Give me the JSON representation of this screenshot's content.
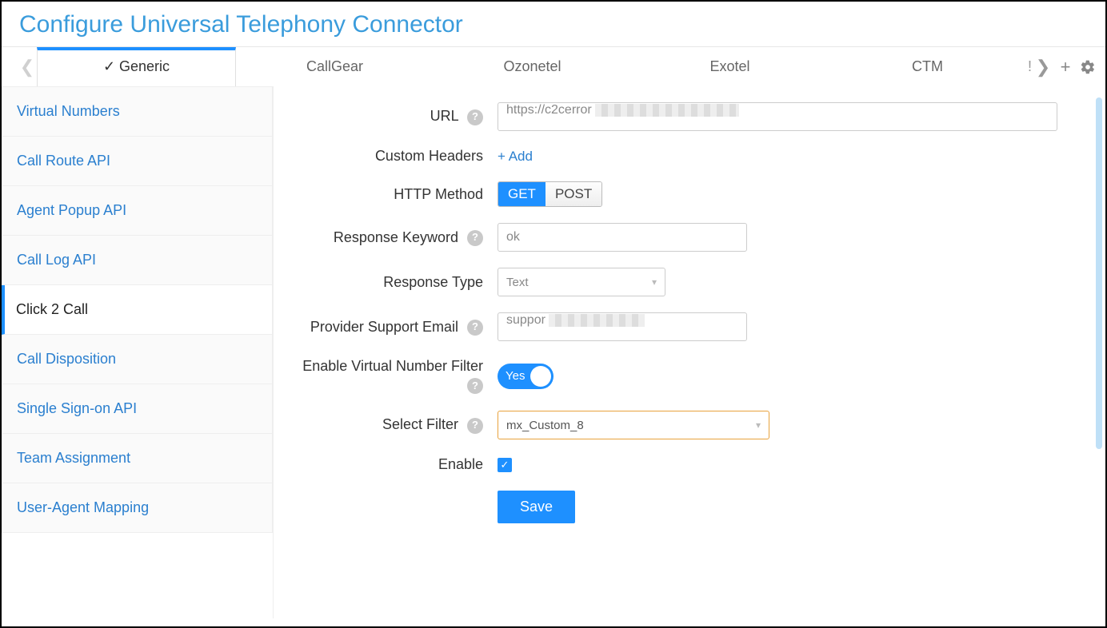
{
  "title": "Configure Universal Telephony Connector",
  "tabs": {
    "items": [
      "✓ Generic",
      "CallGear",
      "Ozonetel",
      "Exotel",
      "CTM"
    ],
    "active_index": 0
  },
  "sidebar": {
    "items": [
      "Virtual Numbers",
      "Call Route API",
      "Agent Popup API",
      "Call Log API",
      "Click 2 Call",
      "Call Disposition",
      "Single Sign-on API",
      "Team Assignment",
      "User-Agent Mapping"
    ],
    "active_index": 4
  },
  "form": {
    "url_label": "URL",
    "url_value": "https://c2cerror",
    "custom_headers_label": "Custom Headers",
    "add_link": "+ Add",
    "http_method_label": "HTTP Method",
    "http_get": "GET",
    "http_post": "POST",
    "response_keyword_label": "Response Keyword",
    "response_keyword_value": "ok",
    "response_type_label": "Response Type",
    "response_type_value": "Text",
    "provider_email_label": "Provider Support Email",
    "provider_email_value": "suppor",
    "enable_vn_filter_label": "Enable Virtual Number Filter",
    "toggle_yes": "Yes",
    "select_filter_label": "Select Filter",
    "select_filter_value": "mx_Custom_8",
    "enable_label": "Enable",
    "save": "Save"
  }
}
